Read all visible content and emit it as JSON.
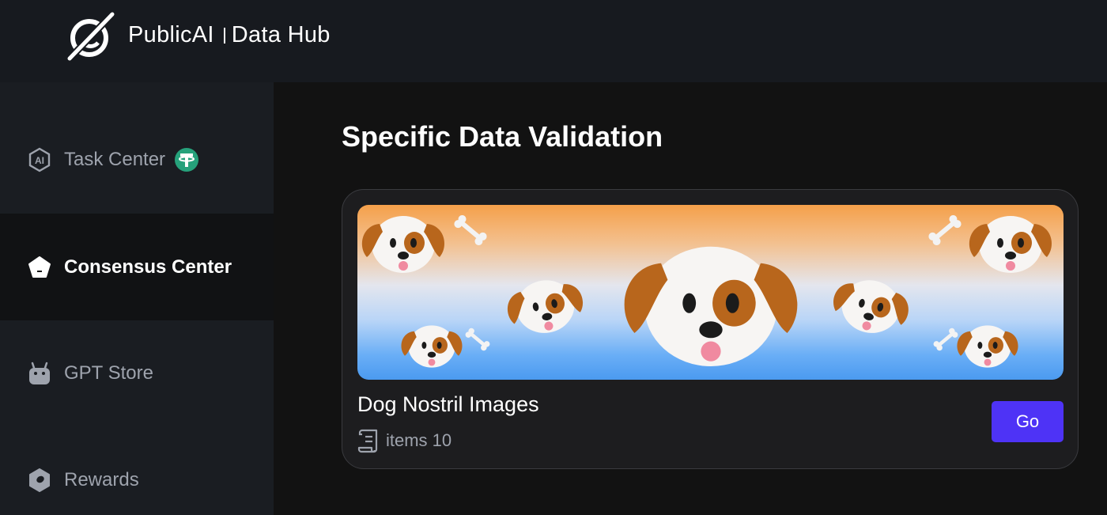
{
  "header": {
    "brand_name": "PublicAI",
    "product_name": "Data Hub",
    "logo_icon": "planet-slash-logo-icon"
  },
  "sidebar": {
    "items": [
      {
        "label": "Task Center",
        "icon": "ai-hexagon-icon",
        "badge_icon": "tether-coin-icon",
        "badge_color": "#26a17b",
        "active": false
      },
      {
        "label": "Consensus Center",
        "icon": "pentagon-icon",
        "active": true
      },
      {
        "label": "GPT Store",
        "icon": "robot-icon",
        "active": false
      },
      {
        "label": "Rewards",
        "icon": "hexagon-ring-icon",
        "active": false
      }
    ]
  },
  "main": {
    "title": "Specific Data Validation",
    "card": {
      "title": "Dog Nostril Images",
      "items_label": "items 10",
      "items_icon": "scroll-list-icon",
      "button_label": "Go",
      "button_color": "#4e33f6",
      "banner_icon": "dog-face-icon"
    }
  }
}
